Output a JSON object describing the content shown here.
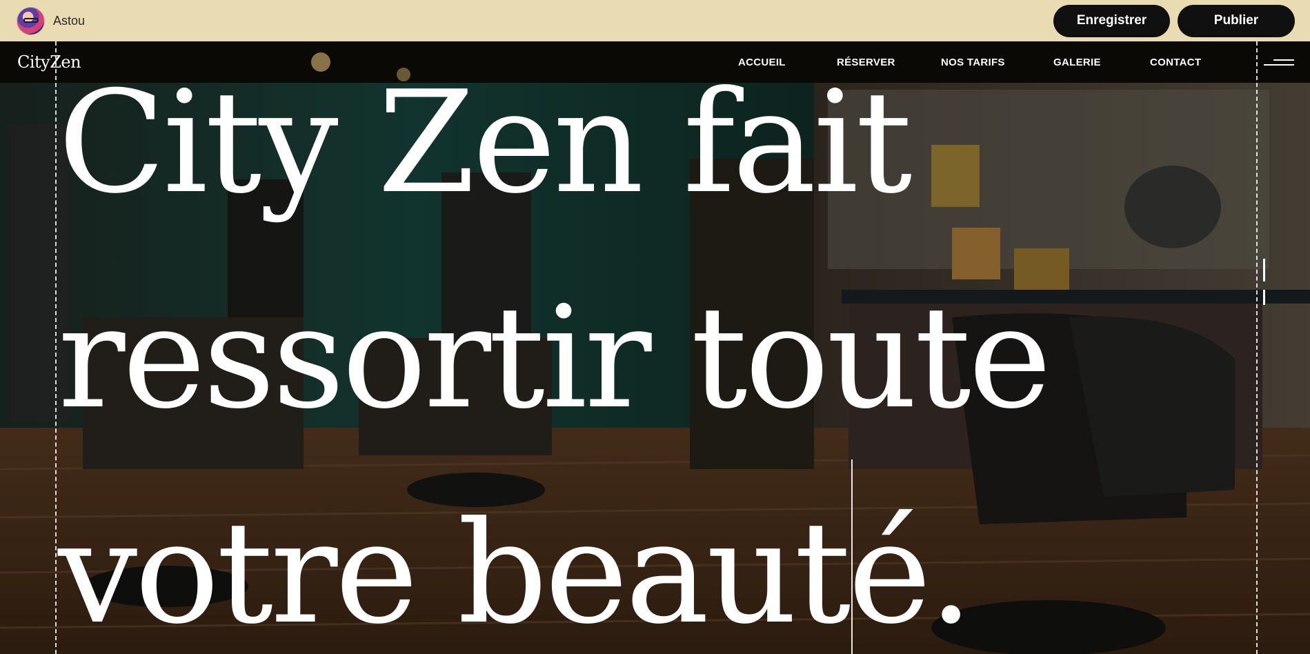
{
  "editor": {
    "user_name": "Astou",
    "save_label": "Enregistrer",
    "publish_label": "Publier"
  },
  "site": {
    "brand": "CityZen",
    "nav": [
      "ACCUEIL",
      "RÉSERVER",
      "NOS TARIFS",
      "GALERIE",
      "CONTACT"
    ],
    "headline": [
      "City Zen fait",
      "ressortir toute",
      "votre beauté."
    ]
  },
  "icons": {
    "avatar": "user-avatar",
    "menu": "hamburger-menu-icon"
  },
  "colors": {
    "topbar_bg": "#e9dcb3",
    "button_bg": "#101010",
    "headline": "#ffffff"
  }
}
